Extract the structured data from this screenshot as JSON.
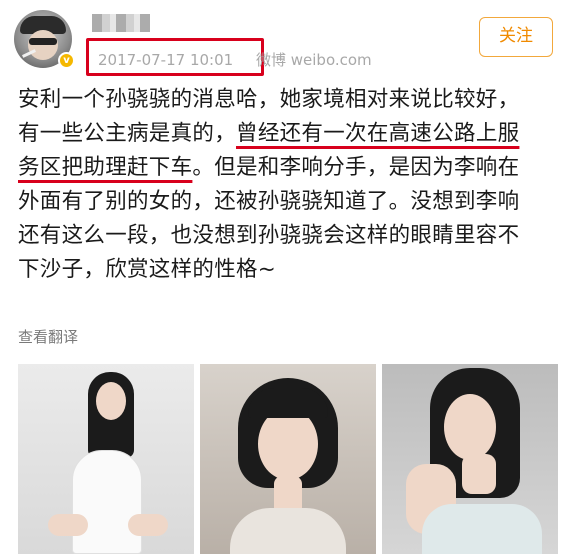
{
  "post": {
    "timestamp": "2017-07-17 10:01",
    "source": "微博 weibo.com",
    "follow_label": "关注",
    "text_lines": {
      "l1": "安利一个孙骁骁的消息哈，她家境相对来说比较好，",
      "l2a": "有一些公主病是真的，",
      "l2b": "曾经还有一次在高速公路上服",
      "l3a": "务区把助理赶下车",
      "l3b": "。但是和李响分手，是因为李响在",
      "l4": "外面有了别的女的，还被孙骁骁知道了。没想到李响",
      "l5": "还有这么一段，也没想到孙骁骁会这样的眼睛里容不",
      "l6": "下沙子，欣赏这样的性格~"
    },
    "translate_label": "查看翻译"
  },
  "icons": {
    "vip_badge": "v-badge-icon"
  },
  "colors": {
    "highlight": "#d8001c",
    "follow": "#f08a00",
    "meta": "#a8a8a8"
  }
}
